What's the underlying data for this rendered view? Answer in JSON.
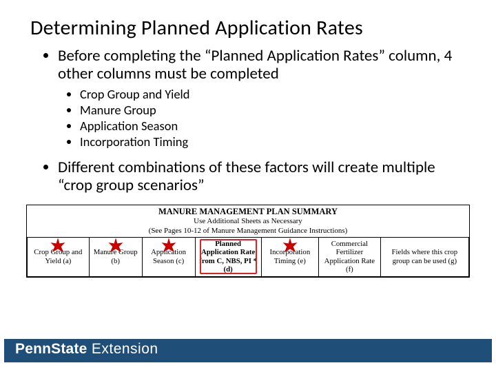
{
  "title": "Determining Planned Application Rates",
  "bullets": {
    "b1": "Before completing the “Planned Application Rates” column, 4 other columns must be completed",
    "sub": {
      "s1": "Crop Group and Yield",
      "s2": "Manure Group",
      "s3": "Application Season",
      "s4": "Incorporation Timing"
    },
    "b2": "Different combinations of these factors will create multiple “crop group scenarios”"
  },
  "summary_table": {
    "heading": "MANURE MANAGEMENT PLAN SUMMARY",
    "sub1": "Use Additional Sheets as Necessary",
    "sub2": "(See Pages 10-12 of Manure Management Guidance Instructions)",
    "cols": {
      "a": "Crop Group and Yield (a)",
      "b": "Manure Group (b)",
      "c": "Application Season (c)",
      "d": "Planned Application Rate from C, NBS, PI * (d)",
      "e": "Incorporation Timing (e)",
      "f": "Commercial Fertilizer Application Rate (f)",
      "g": "Fields where this crop group can be used (g)"
    }
  },
  "brand": {
    "part1": "Penn",
    "part2": "State",
    "part3": " Extension"
  }
}
